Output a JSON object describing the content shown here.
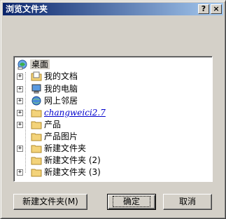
{
  "window": {
    "title": "浏览文件夹",
    "help_glyph": "?",
    "close_glyph": "×"
  },
  "tree": {
    "items": [
      {
        "label": "桌面",
        "icon": "desktop-icon",
        "has_expander": false,
        "selected": true
      },
      {
        "label": "我的文档",
        "icon": "my-documents-icon",
        "has_expander": true
      },
      {
        "label": "我的电脑",
        "icon": "my-computer-icon",
        "has_expander": true
      },
      {
        "label": "网上邻居",
        "icon": "network-places-icon",
        "has_expander": true
      },
      {
        "label": "changweici2.7",
        "icon": "folder-icon",
        "has_expander": true,
        "style": "link"
      },
      {
        "label": "产品",
        "icon": "folder-icon",
        "has_expander": true
      },
      {
        "label": "产品图片",
        "icon": "folder-icon",
        "has_expander": false
      },
      {
        "label": "新建文件夹",
        "icon": "folder-icon",
        "has_expander": true
      },
      {
        "label": "新建文件夹 (2)",
        "icon": "folder-icon",
        "has_expander": false
      },
      {
        "label": "新建文件夹 (3)",
        "icon": "folder-icon",
        "has_expander": true
      }
    ],
    "expander_glyph": "+"
  },
  "buttons": {
    "new_folder": "新建文件夹(M)",
    "ok": "确定",
    "cancel": "取消"
  },
  "colors": {
    "title_start": "#0a246a",
    "title_end": "#a6caf0",
    "face": "#d4d0c8",
    "folder": "#f3d37a"
  }
}
